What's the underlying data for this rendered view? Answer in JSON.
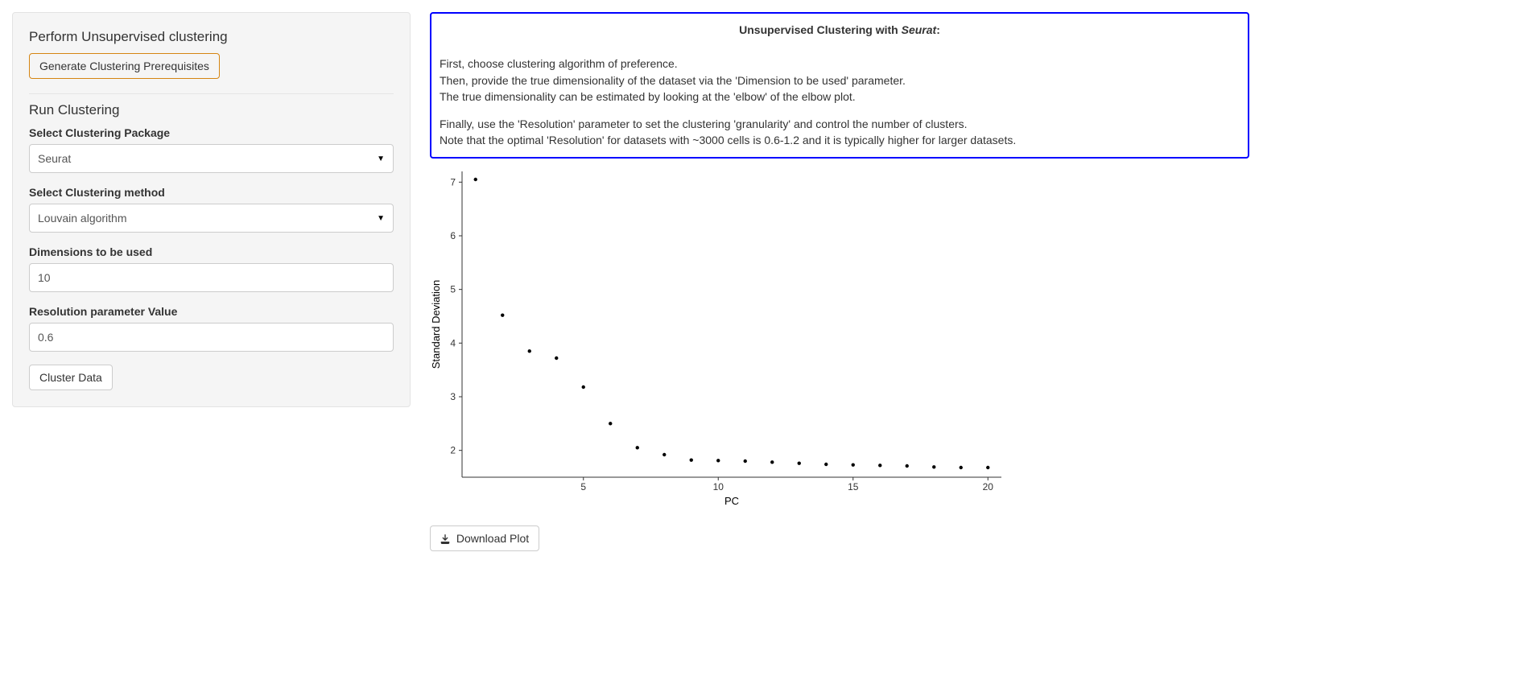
{
  "panel": {
    "section1_title": "Perform Unsupervised clustering",
    "generate_btn": "Generate Clustering Prerequisites",
    "section2_title": "Run Clustering",
    "package_label": "Select Clustering Package",
    "package_value": "Seurat",
    "method_label": "Select Clustering method",
    "method_value": "Louvain algorithm",
    "dims_label": "Dimensions to be used",
    "dims_value": "10",
    "res_label": "Resolution parameter Value",
    "res_value": "0.6",
    "cluster_btn": "Cluster Data"
  },
  "info": {
    "title_pre": "Unsupervised Clustering with ",
    "title_ital": "Seurat",
    "title_post": ":",
    "line1": "First, choose clustering algorithm of preference.",
    "line2": "Then, provide the true dimensionality of the dataset via the 'Dimension to be used' parameter.",
    "line3": "The true dimensionality can be estimated by looking at the 'elbow' of the elbow plot.",
    "line4": "Finally, use the 'Resolution' parameter to set the clustering 'granularity' and control the number of clusters.",
    "line5": "Note that the optimal 'Resolution' for datasets with ~3000 cells is 0.6-1.2 and it is typically higher for larger datasets."
  },
  "download_btn": " Download Plot",
  "chart_data": {
    "type": "scatter",
    "xlabel": "PC",
    "ylabel": "Standard Deviation",
    "xlim": [
      0.5,
      20.5
    ],
    "ylim": [
      1.5,
      7.2
    ],
    "x_ticks": [
      5,
      10,
      15,
      20
    ],
    "y_ticks": [
      2,
      3,
      4,
      5,
      6,
      7
    ],
    "x": [
      1,
      2,
      3,
      4,
      5,
      6,
      7,
      8,
      9,
      10,
      11,
      12,
      13,
      14,
      15,
      16,
      17,
      18,
      19,
      20
    ],
    "y": [
      7.05,
      4.52,
      3.85,
      3.72,
      3.18,
      2.5,
      2.05,
      1.92,
      1.82,
      1.81,
      1.8,
      1.78,
      1.76,
      1.74,
      1.73,
      1.72,
      1.71,
      1.69,
      1.68,
      1.68
    ]
  }
}
